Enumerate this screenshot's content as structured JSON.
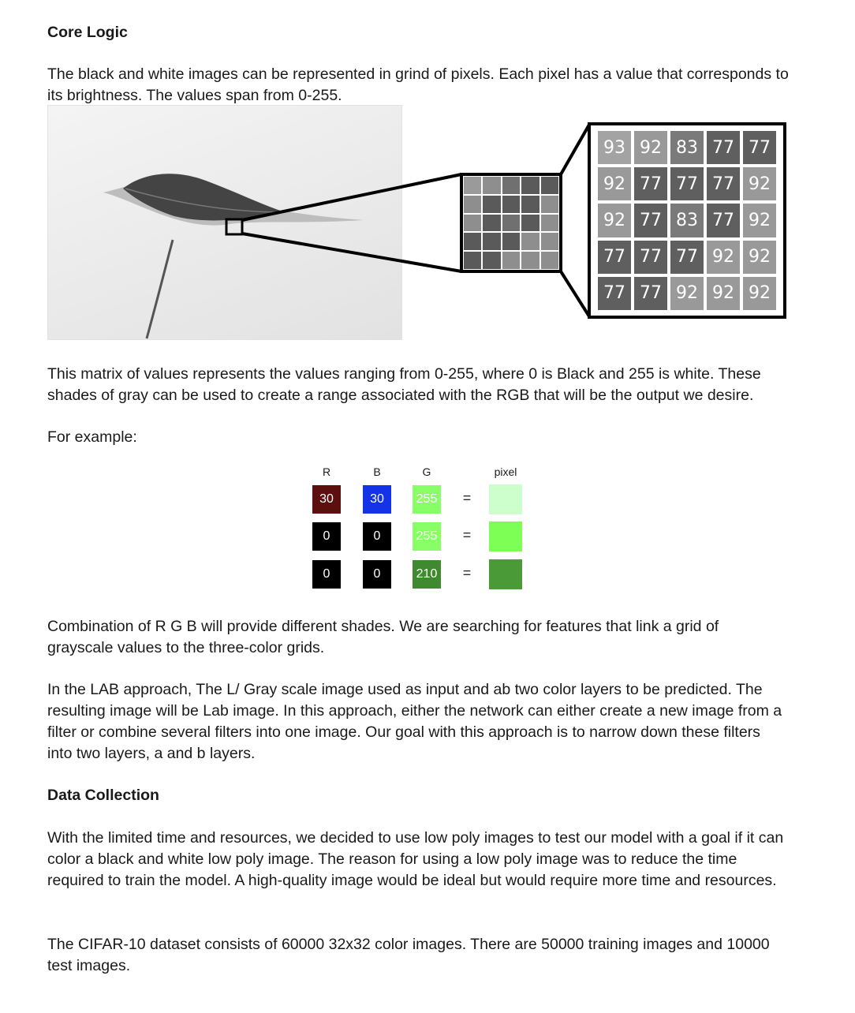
{
  "core_logic": {
    "heading": "Core Logic",
    "intro": "The black and white images can be represented in grind of pixels. Each pixel has a value that corresponds to its brightness. The values span from 0-255.",
    "matrix_values": [
      [
        "93",
        "92",
        "83",
        "77",
        "77"
      ],
      [
        "92",
        "77",
        "77",
        "77",
        "92"
      ],
      [
        "92",
        "77",
        "83",
        "77",
        "92"
      ],
      [
        "77",
        "77",
        "77",
        "92",
        "92"
      ],
      [
        "77",
        "77",
        "92",
        "92",
        "92"
      ]
    ],
    "matrix_explanation": "This matrix of values represents the values ranging from 0-255, where 0 is Black and 255 is white. These shades of gray can be used to create a range associated with the RGB that will be the output we desire.",
    "example_label": "For example:"
  },
  "rgb_example": {
    "headers": {
      "r": "R",
      "b": "B",
      "g": "G",
      "pixel": "pixel"
    },
    "rows": [
      {
        "r": "30",
        "b": "30",
        "g": "255",
        "eq": "=",
        "pixel_color": "#ccffcc"
      },
      {
        "r": "0",
        "b": "0",
        "g": "255",
        "eq": "=",
        "pixel_color": "#7dff55"
      },
      {
        "r": "0",
        "b": "0",
        "g": "210",
        "eq": "=",
        "pixel_color": "#4a9a38"
      }
    ],
    "colors": {
      "r_first": "#5c0f0f",
      "b_first": "#1433e6",
      "g_bright": "#88ff66",
      "g_dark": "#3f8a2e",
      "black": "#000000"
    }
  },
  "paragraphs": {
    "combination": "Combination of R G B will provide different shades. We are searching for features that link a grid of grayscale values to the three-color grids.",
    "lab": "In the LAB approach, The L/ Gray scale image used as input and ab two color layers to be predicted. The resulting image will be Lab image. In this approach, either the network can either create a new image from a filter or combine several filters into one image. Our goal with this approach is to narrow down these filters into two layers, a and b layers."
  },
  "data_collection": {
    "heading": "Data Collection",
    "p1": "With the limited time and resources, we decided to use low poly images to test our model with a goal if it can color a black and white low poly image. The reason for using a low poly image was to reduce the time required to train the model. A high-quality image would be ideal but would require more time and resources.",
    "p2": "The CIFAR-10 dataset consists of 60000 32x32 color images. There are 50000 training images and 10000 test images."
  }
}
